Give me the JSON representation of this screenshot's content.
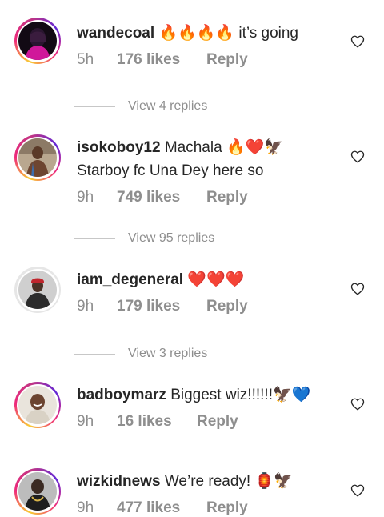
{
  "comments": [
    {
      "username": "wandecoal",
      "text_parts": [
        "🔥🔥🔥🔥",
        " it’s going"
      ],
      "time": "5h",
      "likes": "176 likes",
      "reply": "Reply",
      "avatar_icon": "profile-photo-pink-lit-portrait"
    },
    {
      "username": "isokoboy12",
      "text_line1": "Machala",
      "text_emoji1": "🔥❤️🦅",
      "text_line2": "Starboy fc Una Dey here so",
      "time": "9h",
      "likes": "749 likes",
      "reply": "Reply",
      "avatar_icon": "profile-photo-man-shirtless"
    },
    {
      "username": "iam_degeneral",
      "text_emoji": "❤️❤️❤️",
      "time": "9h",
      "likes": "179 likes",
      "reply": "Reply",
      "avatar_icon": "profile-photo-man-red-cap"
    },
    {
      "username": "badboymarz",
      "text": "Biggest wiz!!!!!!",
      "text_emoji": "🦅💙",
      "time": "9h",
      "likes": "16 likes",
      "reply": "Reply",
      "avatar_icon": "profile-photo-smiling-man"
    },
    {
      "username": "wizkidnews",
      "text": "We’re ready!",
      "text_emoji": "🏮🦅",
      "time": "9h",
      "likes": "477 likes",
      "reply": "Reply",
      "avatar_icon": "profile-photo-man-chain"
    }
  ],
  "view_replies": [
    "View 4 replies",
    "View 95 replies",
    "View 3 replies"
  ],
  "icons": {
    "like": "heart-outline-icon"
  },
  "colors": {
    "text": "#262626",
    "muted": "#8e8e8e",
    "story_ring_start": "#f9ce34",
    "story_ring_end": "#6228d7"
  }
}
